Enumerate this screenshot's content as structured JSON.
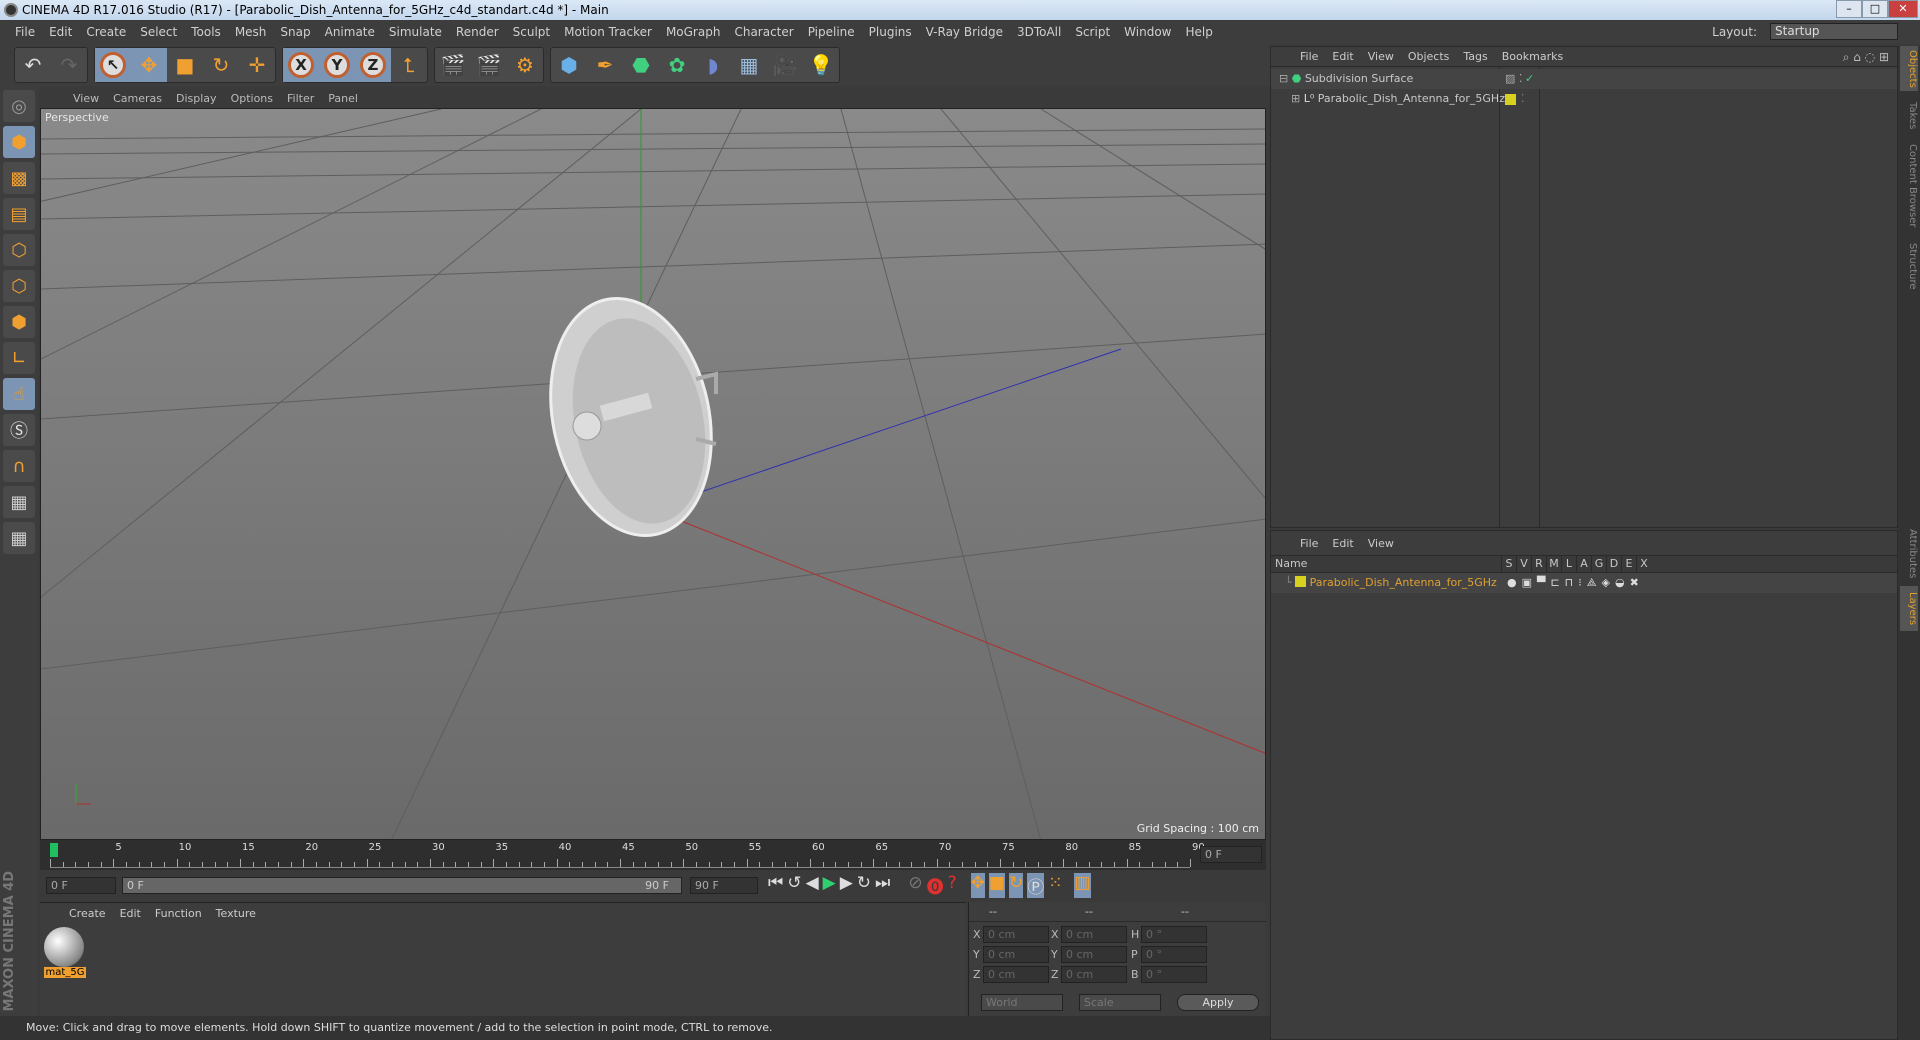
{
  "window": {
    "title": "CINEMA 4D R17.016 Studio (R17) - [Parabolic_Dish_Antenna_for_5GHz_c4d_standart.c4d *] - Main"
  },
  "menu": [
    "File",
    "Edit",
    "Create",
    "Select",
    "Tools",
    "Mesh",
    "Snap",
    "Animate",
    "Simulate",
    "Render",
    "Sculpt",
    "Motion Tracker",
    "MoGraph",
    "Character",
    "Pipeline",
    "Plugins",
    "V-Ray Bridge",
    "3DToAll",
    "Script",
    "Window",
    "Help"
  ],
  "layout": {
    "label": "Layout:",
    "value": "Startup"
  },
  "toolbar": {
    "axis_x": "X",
    "axis_y": "Y",
    "axis_z": "Z"
  },
  "viewport": {
    "menu": [
      "View",
      "Cameras",
      "Display",
      "Options",
      "Filter",
      "Panel"
    ],
    "camera": "Perspective",
    "grid_spacing": "Grid Spacing : 100 cm"
  },
  "timeline": {
    "ticks": [
      "0",
      "5",
      "10",
      "15",
      "20",
      "25",
      "30",
      "35",
      "40",
      "45",
      "50",
      "55",
      "60",
      "65",
      "70",
      "75",
      "80",
      "85",
      "90"
    ],
    "current_frame": "0 F",
    "start": "0 F",
    "range_start": "0 F",
    "range_end": "90 F",
    "end": "90 F"
  },
  "material_manager": {
    "menu": [
      "Create",
      "Edit",
      "Function",
      "Texture"
    ],
    "materials": [
      {
        "name": "mat_5G"
      }
    ]
  },
  "coordinates": {
    "headers": [
      "--",
      "--",
      "--"
    ],
    "rows": [
      {
        "a": "X",
        "av": "0 cm",
        "b": "X",
        "bv": "0 cm",
        "c": "H",
        "cv": "0 °"
      },
      {
        "a": "Y",
        "av": "0 cm",
        "b": "Y",
        "bv": "0 cm",
        "c": "P",
        "cv": "0 °"
      },
      {
        "a": "Z",
        "av": "0 cm",
        "b": "Z",
        "bv": "0 cm",
        "c": "B",
        "cv": "0 °"
      }
    ],
    "mode": "World",
    "transform": "Scale",
    "apply": "Apply"
  },
  "status": "Move: Click and drag to move elements. Hold down SHIFT to quantize movement / add to the selection in point mode, CTRL to remove.",
  "object_manager": {
    "menu": [
      "File",
      "Edit",
      "View",
      "Objects",
      "Tags",
      "Bookmarks"
    ],
    "objects": [
      {
        "name": "Subdivision Surface"
      },
      {
        "name": "Parabolic_Dish_Antenna_for_5GHz"
      }
    ]
  },
  "layer_manager": {
    "menu": [
      "File",
      "Edit",
      "View"
    ],
    "columns": [
      "Name",
      "S",
      "V",
      "R",
      "M",
      "L",
      "A",
      "G",
      "D",
      "E",
      "X"
    ],
    "layers": [
      {
        "name": "Parabolic_Dish_Antenna_for_5GHz",
        "color": "#d8d020"
      }
    ]
  },
  "right_tabs": [
    "Objects",
    "Takes",
    "Content Browser",
    "Structure",
    "Attributes",
    "Layers"
  ],
  "brand": "MAXON CINEMA 4D",
  "colors": {
    "accent": "#7d95b4",
    "layer_name": "#e0a030",
    "playhead": "#20c060"
  }
}
